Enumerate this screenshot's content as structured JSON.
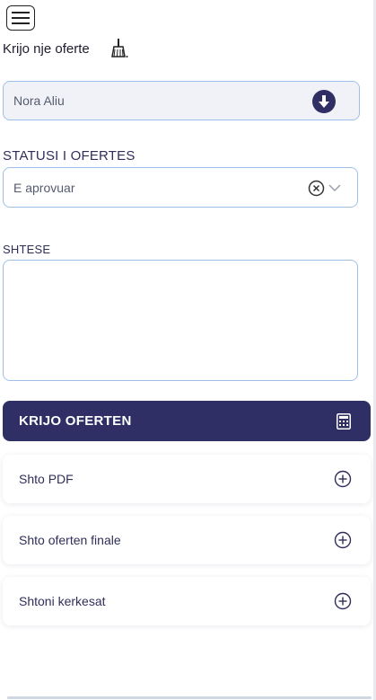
{
  "header": {
    "menu_icon": "hamburger-menu-icon",
    "title": "Krijo nje oferte",
    "clear_icon": "broom-icon"
  },
  "client": {
    "name": "Nora Aliu",
    "icon": "download-circle-icon"
  },
  "status": {
    "label": "STATUSI I OFERTES",
    "value": "E aprovuar",
    "clear_icon": "clear-x-icon",
    "dropdown_icon": "chevron-down-icon"
  },
  "notes": {
    "label": "SHTESE",
    "value": ""
  },
  "create_button": {
    "label": "KRIJO OFERTEN",
    "icon": "calculator-icon"
  },
  "actions": [
    {
      "label": "Shto PDF",
      "icon": "plus-circle-icon"
    },
    {
      "label": "Shto oferten finale",
      "icon": "plus-circle-icon"
    },
    {
      "label": "Shtoni kerkesat",
      "icon": "plus-circle-icon"
    }
  ],
  "colors": {
    "primary": "#2f2f66",
    "input_border": "#9ec0e8",
    "input_bg": "#f1f2f7",
    "text": "#2f2f5a"
  }
}
